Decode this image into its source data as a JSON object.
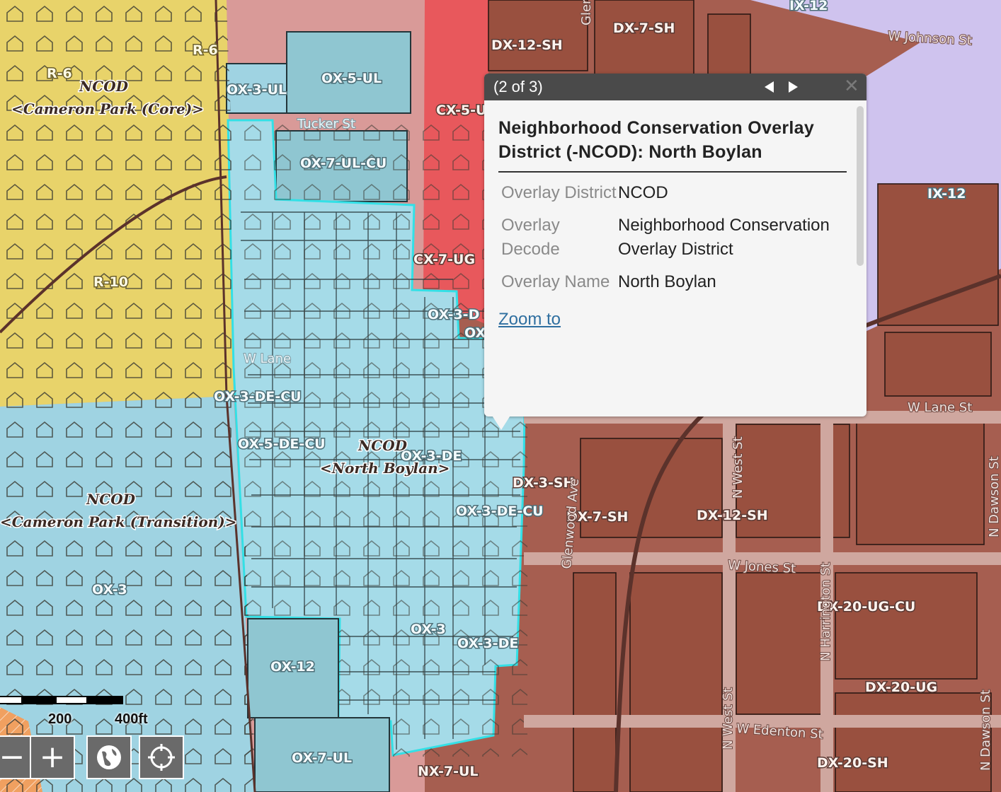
{
  "popup": {
    "counter": "(2 of 3)",
    "feature_title": "Neighborhood Conservation Overlay District (-NCOD): North Boylan",
    "attributes": [
      {
        "label": "Overlay District",
        "value": "NCOD"
      },
      {
        "label": "Overlay Decode",
        "value": "Neighborhood Conservation Overlay District"
      },
      {
        "label": "Overlay Name",
        "value": "North Boylan"
      }
    ],
    "zoom_link": "Zoom to"
  },
  "scalebar": {
    "label_mid": "200",
    "label_end": "400ft"
  },
  "controls": {
    "zoom_out": "−",
    "zoom_in": "+"
  },
  "colors": {
    "downtown_mixed": "#a65e50",
    "office_mixed": "#9fd3e2",
    "residential": "#e8d36a",
    "commercial_mixed": "#e8585c",
    "industrial_mixed": "#cfc3ee",
    "selection_outline": "#33e0e6",
    "popup_header": "#4a4a4a",
    "link": "#2f6fa0"
  },
  "map": {
    "zone_labels": [
      "IX-12",
      "DX-7-SH",
      "DX-12-SH",
      "OX-5-UL",
      "OX-3-UL",
      "R-6",
      "R-6",
      "CX-5-U",
      "OX-7-UL-CU",
      "IX-12",
      "CX-7-UG",
      "R-10",
      "OX-3-D",
      "OX",
      "OX-3-DE-CU",
      "OX-5-DE-CU",
      "OX-3-DE",
      "DX-3-SH",
      "OX-3-DE-CU",
      "DX-7-SH",
      "DX-12-SH",
      "OX-3",
      "DX-20-UG-CU",
      "OX-3",
      "OX-3-DE",
      "OX-12",
      "DX-20-UG",
      "OX-7-UL",
      "NX-7-UL",
      "DX-20-SH"
    ],
    "overlay_labels": [
      {
        "name": "NCOD",
        "sub": "<Cameron Park (Core)>"
      },
      {
        "name": "NCOD",
        "sub": "<North Boylan>"
      },
      {
        "name": "NCOD",
        "sub": "<Cameron Park (Transition)>"
      }
    ],
    "street_labels": [
      "W Johnson St",
      "Tucker St",
      "W Lane St",
      "W Jones St",
      "W Edenton St",
      "N West St",
      "N West St",
      "N Harrington St",
      "N Dawson St",
      "N Dawson St",
      "Glenwood Ave",
      "W Lane",
      "Glen"
    ]
  }
}
